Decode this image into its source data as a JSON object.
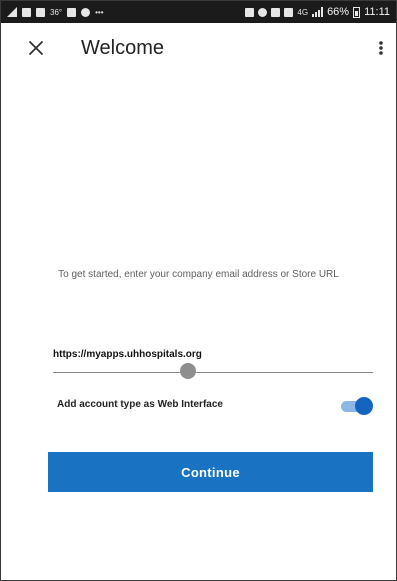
{
  "status_bar": {
    "temperature": "36°",
    "dots": "•••",
    "network_label": "4G",
    "battery_percent": "66%",
    "time": "11:11"
  },
  "header": {
    "title": "Welcome",
    "close_icon": "close-icon",
    "menu_icon": "more-vertical-icon"
  },
  "main": {
    "instruction": "To get started, enter your company email address or Store URL",
    "url_field": {
      "value": "https://myapps.uhhospitals.org"
    },
    "web_interface_toggle": {
      "label": "Add account type as Web Interface",
      "checked": true
    },
    "continue_label": "Continue"
  },
  "colors": {
    "accent": "#1a72c3",
    "toggle_thumb": "#1565c0",
    "toggle_track": "#8cb7e5",
    "status_bar": "#1b1b1b"
  }
}
